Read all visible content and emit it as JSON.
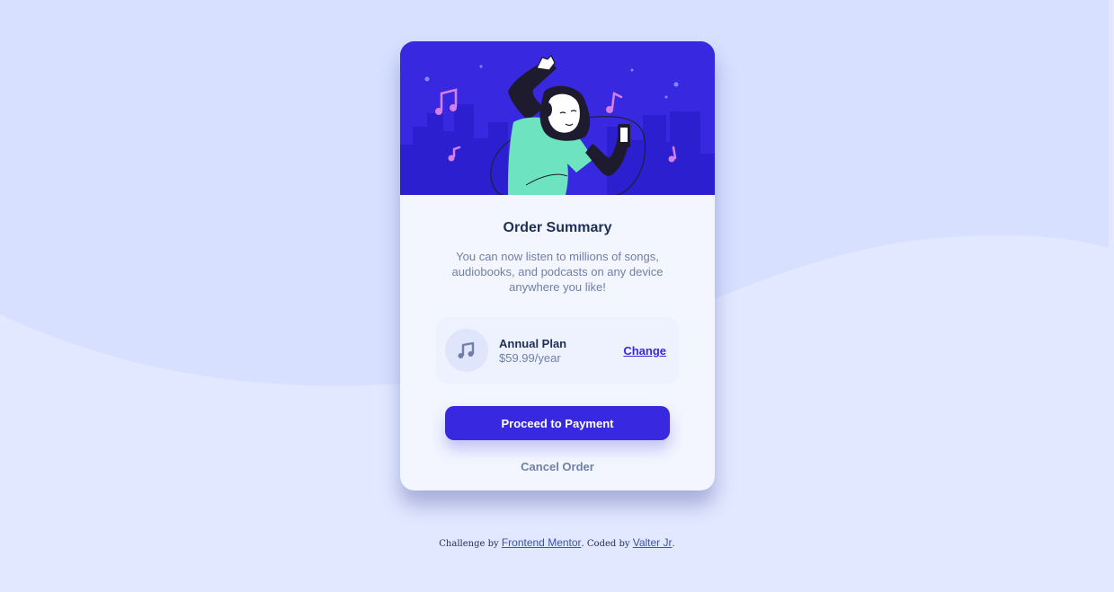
{
  "colors": {
    "page_background": "#d7e0ff",
    "wave_light": "#e2e8ff",
    "card_background": "#f3f6ff",
    "bright_blue": "#3829e0",
    "dark_blue": "#1f2f56",
    "desaturated_blue": "#717fa6",
    "plan_background": "#eef2fe"
  },
  "hero": {
    "illustration": "person-dancing-with-headphones-illustration",
    "icons": [
      "music-note-icon"
    ]
  },
  "card": {
    "title": "Order Summary",
    "description": "You can now listen to millions of songs, audiobooks, and podcasts on any device anywhere you like!",
    "plan": {
      "icon": "music-note-icon",
      "name": "Annual Plan",
      "price": "$59.99/year",
      "change_label": "Change"
    },
    "proceed_label": "Proceed to Payment",
    "cancel_label": "Cancel Order"
  },
  "attribution": {
    "prefix": "Challenge by ",
    "challenge_link": "Frontend Mentor",
    "middle": ". Coded by ",
    "author_link": "Valter Jr",
    "suffix": "."
  }
}
